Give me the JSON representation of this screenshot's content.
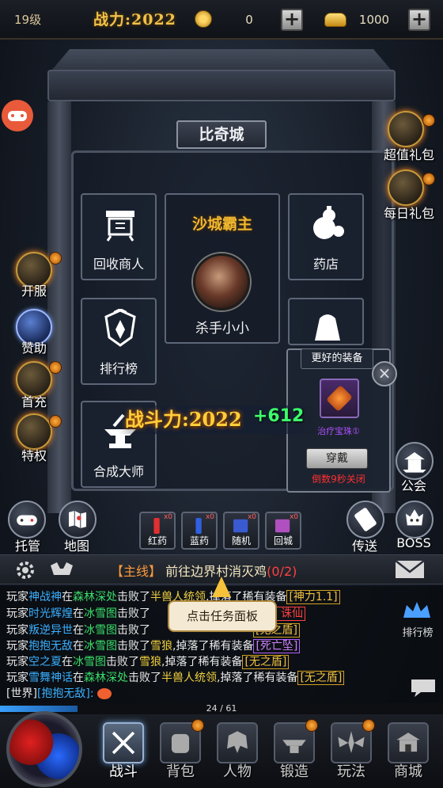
{
  "topbar": {
    "level": "19级",
    "combat_power": "战力:2022",
    "coins": "0",
    "gold": "1000",
    "coin_plus": "+",
    "gold_plus": "+"
  },
  "city": {
    "name": "比奇城",
    "owner_title": "沙城霸主",
    "owner_name": "杀手小小",
    "shops": {
      "recycle": "回收商人",
      "pharmacy": "药店",
      "ranking": "排行榜",
      "synth": "合成大师"
    }
  },
  "left_side": {
    "game_icon": "gamepad-icon",
    "buttons": [
      "开服",
      "赞助",
      "首充",
      "特权"
    ]
  },
  "right_side": {
    "buttons": [
      "超值礼包",
      "每日礼包"
    ],
    "guild": "公会"
  },
  "popup": {
    "title": "更好的装备",
    "item_name": "治疗宝珠①",
    "wear_button": "穿戴",
    "countdown": "倒数9秒关闭",
    "close": "×"
  },
  "combat_banner": {
    "label": "战斗力:2022",
    "increase": "+612"
  },
  "ground_buttons": {
    "auto": "托管",
    "map": "地图",
    "teleport": "传送",
    "boss": "BOSS"
  },
  "quick_items": [
    {
      "label": "红药",
      "count": "x0"
    },
    {
      "label": "蓝药",
      "count": "x0"
    },
    {
      "label": "随机",
      "count": "x0"
    },
    {
      "label": "回城",
      "count": "x0"
    }
  ],
  "quest": {
    "tag": "【主线】",
    "text": "前往边界村消灭鸡",
    "progress": "(0/2)"
  },
  "chat": {
    "lines": [
      {
        "p": "玩家",
        "name": "神战神",
        "at": "在",
        "map": "森林深处",
        "mid": "击败了",
        "mon": "半兽人统领",
        "end": ",掉落了稀有装备",
        "item": "[神力1.1]"
      },
      {
        "p": "玩家",
        "name": "时光辉煌",
        "at": "在",
        "map": "冰雪图",
        "mid": "击败了",
        "mon": "",
        "end": "",
        "item": "【残】诛仙"
      },
      {
        "p": "玩家",
        "name": "叛逆异世",
        "at": "在",
        "map": "冰雪图",
        "mid": "击败了",
        "mon": "",
        "end": "",
        "item": "[无之盾]"
      },
      {
        "p": "玩家",
        "name": "抱抱无敌",
        "at": "在",
        "map": "冰雪图",
        "mid": "击败了",
        "mon": "雪狼",
        "end": ",掉落了稀有装备",
        "item": "[死亡坠]"
      },
      {
        "p": "玩家",
        "name": "空之夏",
        "at": "在",
        "map": "冰雪图",
        "mid": "击败了",
        "mon": "雪狼",
        "end": ",掉落了稀有装备",
        "item": "[无之盾]"
      },
      {
        "p": "玩家",
        "name": "雪舞神话",
        "at": "在",
        "map": "森林深处",
        "mid": "击败了",
        "mon": "半兽人统领",
        "end": ",掉落了稀有装备",
        "item": "[无之盾]"
      }
    ],
    "world_prefix": "[世界]",
    "world_name": "[抱抱无敌]:",
    "tooltip": "点击任务面板",
    "ranking_side": "排行榜"
  },
  "exp": {
    "text": "24 / 61",
    "fraction": 0.39
  },
  "bottom_nav": [
    "战斗",
    "背包",
    "人物",
    "锻造",
    "玩法",
    "商城"
  ],
  "colors": {
    "gold": "#f0c24a",
    "green": "#3cff6a",
    "red": "#ff4040",
    "blue": "#3ab0ff"
  }
}
